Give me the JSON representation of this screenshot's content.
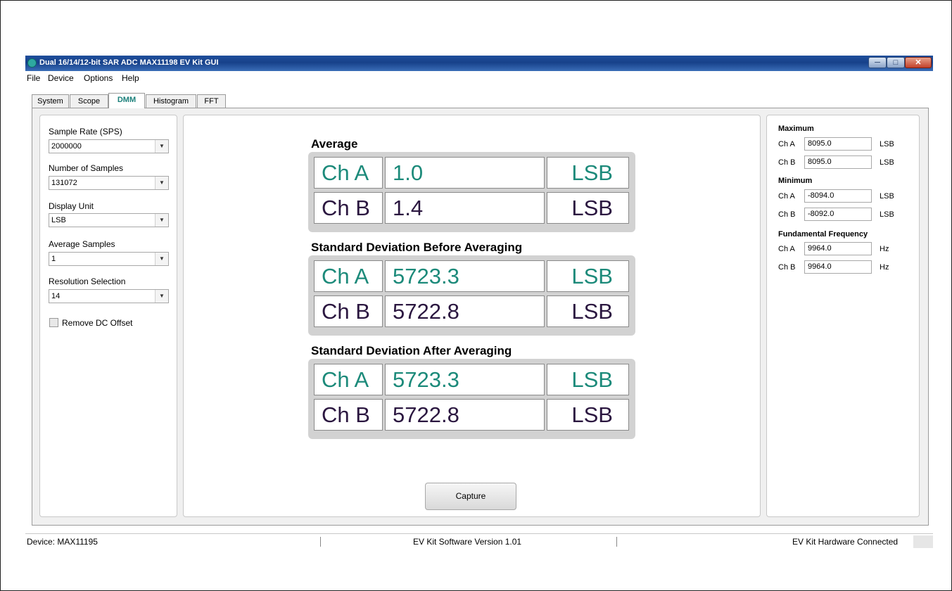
{
  "window": {
    "title": "Dual 16/14/12-bit SAR ADC MAX11198 EV Kit GUI",
    "minimize": "─",
    "maximize": "□",
    "close": "✕"
  },
  "menu": [
    "File",
    "Device",
    "Options",
    "Help"
  ],
  "tabs": [
    "System",
    "Scope",
    "DMM",
    "Histogram",
    "FFT"
  ],
  "active_tab": "DMM",
  "left": {
    "sample_rate": {
      "label": "Sample Rate (SPS)",
      "value": "2000000"
    },
    "num_samples": {
      "label": "Number of Samples",
      "value": "131072"
    },
    "display_unit": {
      "label": "Display Unit",
      "value": "LSB"
    },
    "avg_samples": {
      "label": "Average Samples",
      "value": "1"
    },
    "resolution": {
      "label": "Resolution Selection",
      "value": "14"
    },
    "remove_dc": {
      "label": "Remove DC Offset",
      "checked": false
    },
    "dropdown_arrow": "▼"
  },
  "center": {
    "average": {
      "title": "Average",
      "cha": {
        "label": "Ch A",
        "value": "1.0",
        "unit": "LSB"
      },
      "chb": {
        "label": "Ch B",
        "value": "1.4",
        "unit": "LSB"
      }
    },
    "std_before": {
      "title": "Standard Deviation Before Averaging",
      "cha": {
        "label": "Ch A",
        "value": "5723.3",
        "unit": "LSB"
      },
      "chb": {
        "label": "Ch B",
        "value": "5722.8",
        "unit": "LSB"
      }
    },
    "std_after": {
      "title": "Standard Deviation After Averaging",
      "cha": {
        "label": "Ch A",
        "value": "5723.3",
        "unit": "LSB"
      },
      "chb": {
        "label": "Ch B",
        "value": "5722.8",
        "unit": "LSB"
      }
    },
    "capture": "Capture"
  },
  "right": {
    "maximum": {
      "title": "Maximum",
      "cha": {
        "label": "Ch A",
        "value": "8095.0",
        "unit": "LSB"
      },
      "chb": {
        "label": "Ch B",
        "value": "8095.0",
        "unit": "LSB"
      }
    },
    "minimum": {
      "title": "Minimum",
      "cha": {
        "label": "Ch A",
        "value": "-8094.0",
        "unit": "LSB"
      },
      "chb": {
        "label": "Ch B",
        "value": "-8092.0",
        "unit": "LSB"
      }
    },
    "fundamental": {
      "title": "Fundamental Frequency",
      "cha": {
        "label": "Ch A",
        "value": "9964.0",
        "unit": "Hz"
      },
      "chb": {
        "label": "Ch B",
        "value": "9964.0",
        "unit": "Hz"
      }
    }
  },
  "status": {
    "device": "Device: MAX11195",
    "version": "EV Kit Software Version 1.01",
    "hardware": "EV Kit Hardware Connected"
  },
  "colors": {
    "cha": "#1c8a7a",
    "chb": "#2b1740",
    "active_tab": "#1a7f7a",
    "titlebar": "#1f4f9c"
  }
}
